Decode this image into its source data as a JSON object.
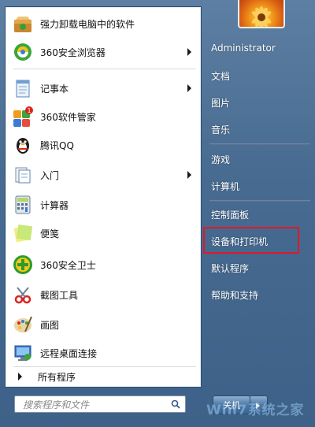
{
  "programs": [
    {
      "label": "强力卸载电脑中的软件",
      "icon": "uninstall-box-icon",
      "has_submenu": false
    },
    {
      "label": "360安全浏览器",
      "icon": "360-browser-icon",
      "has_submenu": true
    },
    {
      "label": "记事本",
      "icon": "notepad-icon",
      "has_submenu": true
    },
    {
      "label": "360软件管家",
      "icon": "360-software-manager-icon",
      "has_submenu": false,
      "badge": "1"
    },
    {
      "label": "腾讯QQ",
      "icon": "qq-penguin-icon",
      "has_submenu": false
    },
    {
      "label": "入门",
      "icon": "getting-started-icon",
      "has_submenu": true
    },
    {
      "label": "计算器",
      "icon": "calculator-icon",
      "has_submenu": false
    },
    {
      "label": "便笺",
      "icon": "sticky-notes-icon",
      "has_submenu": false
    },
    {
      "label": "360安全卫士",
      "icon": "360-safeguard-icon",
      "has_submenu": false
    },
    {
      "label": "截图工具",
      "icon": "snipping-tool-icon",
      "has_submenu": false
    },
    {
      "label": "画图",
      "icon": "paint-palette-icon",
      "has_submenu": false
    },
    {
      "label": "远程桌面连接",
      "icon": "remote-desktop-icon",
      "has_submenu": false
    }
  ],
  "all_programs_label": "所有程序",
  "search": {
    "placeholder": "搜索程序和文件"
  },
  "right": {
    "user": "Administrator",
    "documents": "文档",
    "pictures": "图片",
    "music": "音乐",
    "games": "游戏",
    "computer": "计算机",
    "control_panel": "控制面板",
    "devices_printers": "设备和打印机",
    "default_programs": "默认程序",
    "help_support": "帮助和支持"
  },
  "shutdown_label": "关机",
  "watermark": "Win7系统之家",
  "colors": {
    "highlight_border": "#e0182a",
    "menu_blue": "#486b91"
  }
}
